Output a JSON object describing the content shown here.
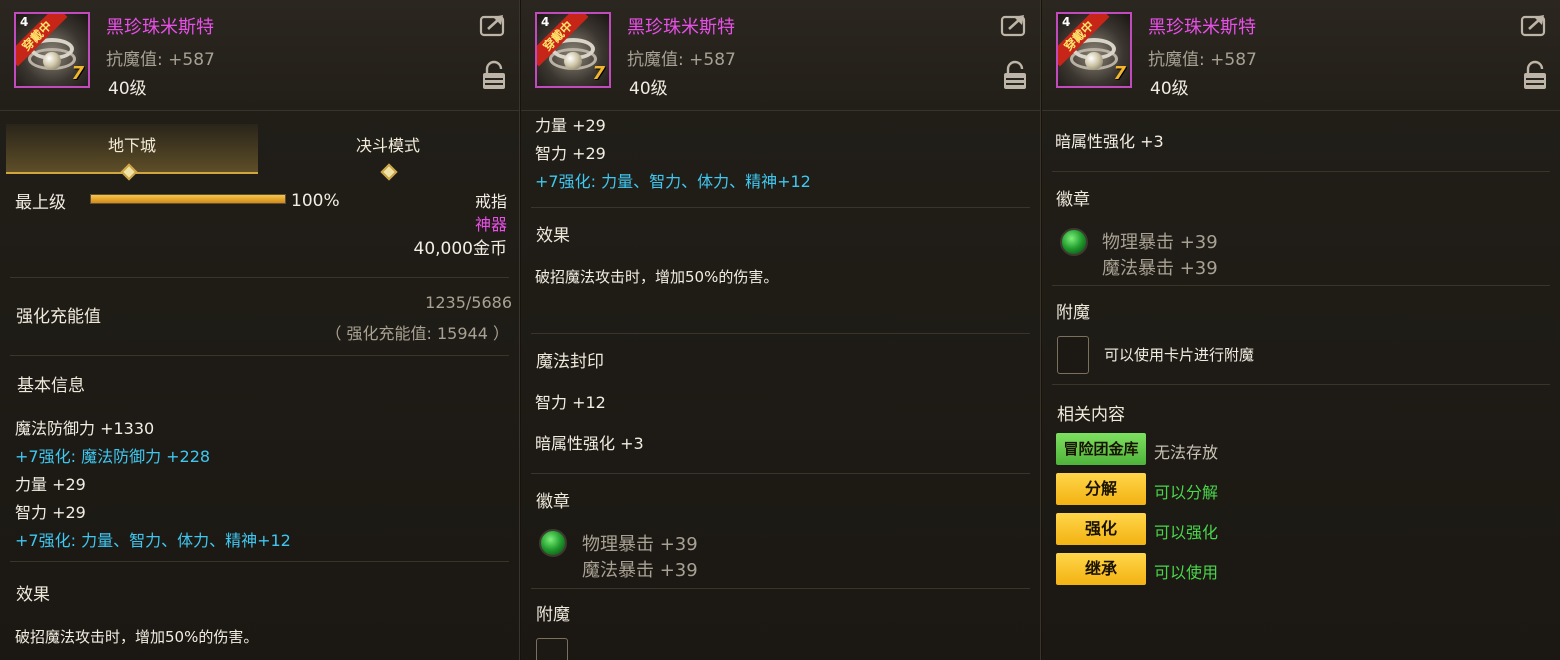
{
  "item": {
    "name": "黑珍珠米斯特",
    "resist": "抗魔值: +587",
    "level": "40级",
    "ribbon": "穿戴中",
    "corner": "4",
    "plus": "7"
  },
  "panel1": {
    "tabs": [
      {
        "label": "地下城"
      },
      {
        "label": "决斗模式"
      }
    ],
    "grade": "最上级",
    "grade_progress": 100,
    "grade_percent": "100%",
    "item_type": "戒指",
    "rarity": "神器",
    "price": "40,000金币",
    "charge_label": "强化充能值",
    "charge_value": "1235/5686",
    "charge_total": "（ 强化充能值: 15944 ）",
    "basic_title": "基本信息",
    "basic_lines": [
      {
        "text": "魔法防御力 +1330",
        "color": "white"
      },
      {
        "text": "+7强化: 魔法防御力 +228",
        "color": "cyan"
      },
      {
        "text": "力量 +29",
        "color": "white"
      },
      {
        "text": "智力 +29",
        "color": "white"
      },
      {
        "text": "+7强化: 力量、智力、体力、精神+12",
        "color": "cyan"
      }
    ],
    "effect_title": "效果",
    "effect_text": "破招魔法攻击时，增加50%的伤害。"
  },
  "panel2": {
    "lines_top": [
      {
        "text": "力量 +29",
        "color": "white"
      },
      {
        "text": "智力 +29",
        "color": "white"
      },
      {
        "text": "+7强化: 力量、智力、体力、精神+12",
        "color": "cyan"
      }
    ],
    "effect_title": "效果",
    "effect_text": "破招魔法攻击时，增加50%的伤害。",
    "seal_title": "魔法封印",
    "seal_lines": [
      "智力 +12",
      "暗属性强化 +3"
    ],
    "emblem_title": "徽章",
    "emblem_lines": [
      "物理暴击 +39",
      "魔法暴击 +39"
    ],
    "enchant_title": "附魔"
  },
  "panel3": {
    "top_line": "暗属性强化 +3",
    "emblem_title": "徽章",
    "emblem_lines": [
      "物理暴击 +39",
      "魔法暴击 +39"
    ],
    "enchant_title": "附魔",
    "enchant_text": "可以使用卡片进行附魔",
    "related_title": "相关内容",
    "related": [
      {
        "tag": "冒险团金库",
        "desc": "无法存放",
        "tag_color": "#5ec94a",
        "desc_color": "#c8c2b5"
      },
      {
        "tag": "分解",
        "desc": "可以分解",
        "tag_color": "#f6c021",
        "desc_color": "#49d64a"
      },
      {
        "tag": "强化",
        "desc": "可以强化",
        "tag_color": "#f6c021",
        "desc_color": "#49d64a"
      },
      {
        "tag": "继承",
        "desc": "可以使用",
        "tag_color": "#f6c021",
        "desc_color": "#49d64a"
      }
    ]
  },
  "icons": {
    "share": "share-icon",
    "lock": "lock-icon",
    "gem": "green-gem-icon",
    "card": "card-slot-icon"
  },
  "colors": {
    "name": "#e84fe7",
    "cyan": "#3ec7f0",
    "green": "#49d64a",
    "gold": "#d0a540"
  }
}
